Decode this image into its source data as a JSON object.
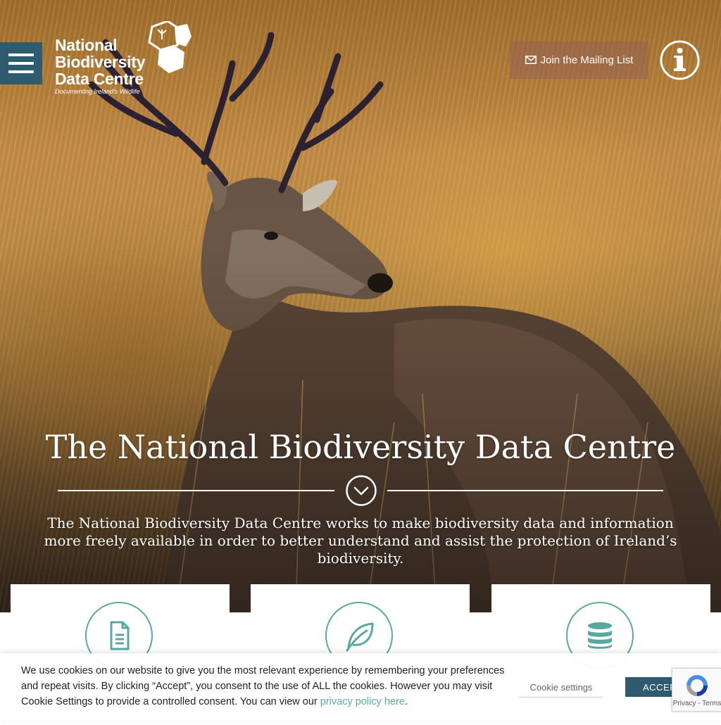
{
  "header": {
    "logo": {
      "line1": "National",
      "line2": "Biodiversity",
      "line3": "Data Centre",
      "tagline": "Documenting Ireland's Wildlife"
    },
    "mailing_list_label": "Join the Mailing List",
    "icons": {
      "menu": "hamburger-menu-icon",
      "mail": "envelope-icon",
      "info": "info-icon"
    }
  },
  "hero": {
    "title": "The National Biodiversity Data Centre",
    "description": "The National Biodiversity Data Centre works to make biodiversity data and information more freely available in order to better understand and assist the protection of Ireland’s biodiversity.",
    "scroll_icon": "chevron-down-icon"
  },
  "cards": [
    {
      "icon": "document-icon",
      "value": ""
    },
    {
      "icon": "leaf-icon",
      "value": ""
    },
    {
      "icon": "database-icon",
      "value": ""
    }
  ],
  "cookie_banner": {
    "text": "We use cookies on our website to give you the most relevant experience by remembering your preferences and repeat visits. By clicking “Accept”, you consent to the use of ALL the cookies. However you may visit Cookie Settings to provide a controlled consent. You can view our ",
    "link_text": "privacy policy here",
    "trailing": ".",
    "settings_label": "Cookie settings",
    "accept_label": "ACCEPT"
  },
  "recaptcha": {
    "links": "Privacy - Terms"
  },
  "colors": {
    "accent": "#2e5b70",
    "teal": "#5aa9a0"
  }
}
